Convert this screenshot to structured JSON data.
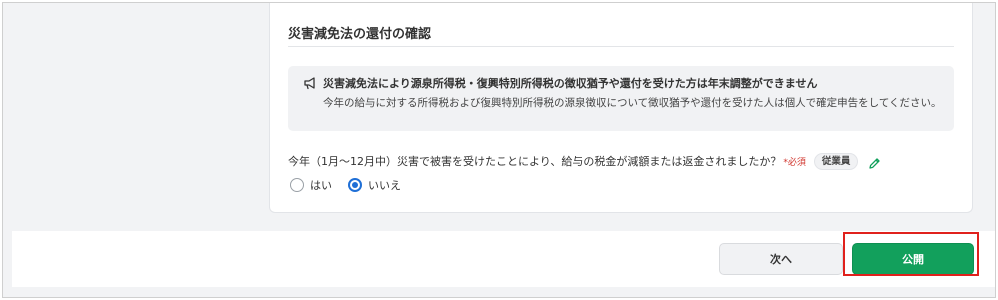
{
  "section": {
    "title": "災害減免法の還付の確認"
  },
  "notice": {
    "icon": "megaphone-icon",
    "title": "災害減免法により源泉所得税・復興特別所得税の徴収猶予や還付を受けた方は年末調整ができません",
    "body": "今年の給与に対する所得税および復興特別所得税の源泉徴収について徴収猶予や還付を受けた人は個人で確定申告をしてください。"
  },
  "question": {
    "text": "今年（1月〜12月中）災害で被害を受けたことにより、給与の税金が減額または返金されましたか？",
    "required_mark": "*必須",
    "role_badge": "従業員",
    "edit_icon": "pencil-icon",
    "options": [
      {
        "label": "はい",
        "selected": false
      },
      {
        "label": "いいえ",
        "selected": true
      }
    ]
  },
  "footer": {
    "next_label": "次へ",
    "publish_label": "公開"
  },
  "colors": {
    "primary_green": "#12a05c",
    "radio_blue": "#1f6fd6",
    "required_red": "#d0342c",
    "highlight_red": "#e0211c"
  }
}
